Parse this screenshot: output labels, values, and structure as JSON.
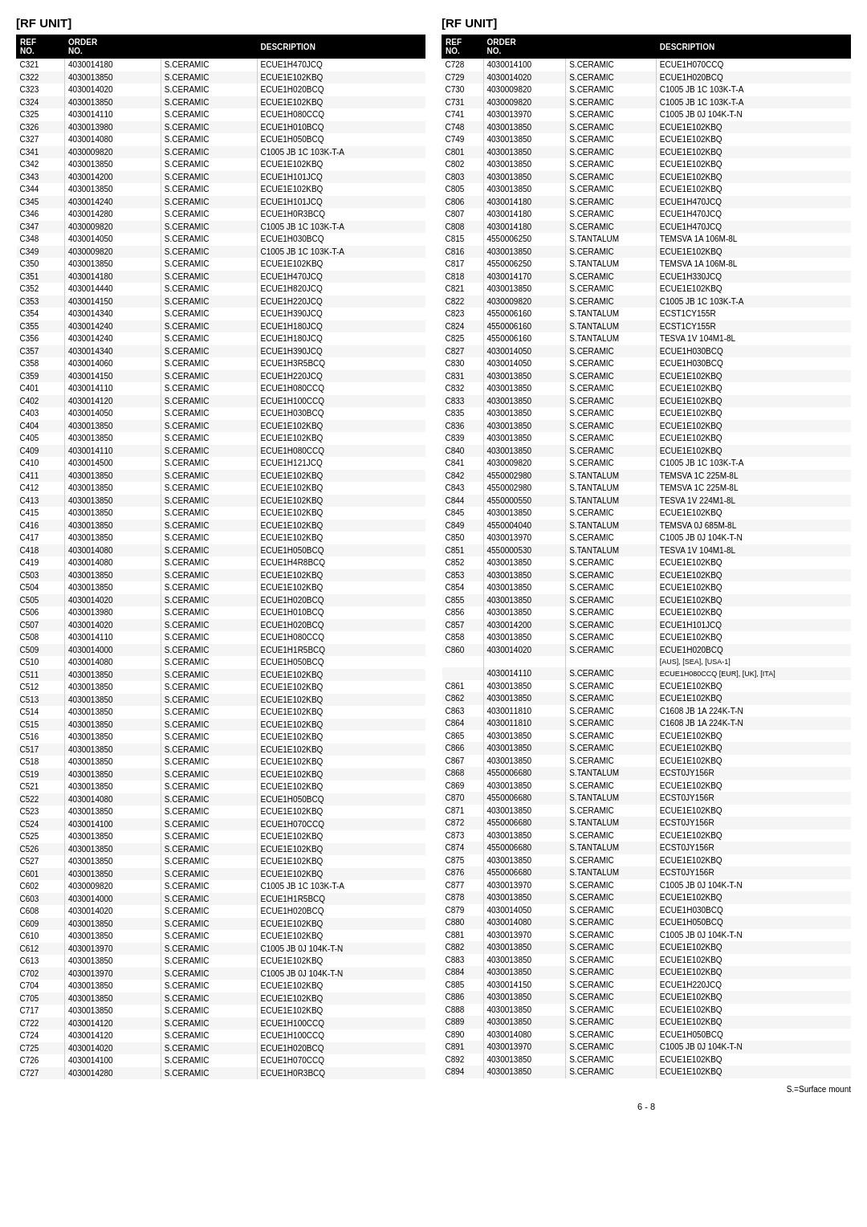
{
  "page": {
    "title_left": "[RF UNIT]",
    "title_right": "[RF UNIT]",
    "footer_note": "S.=Surface mount",
    "page_number": "6 - 8"
  },
  "left_table": {
    "headers": [
      "REF\nNO.",
      "ORDER\nNO.",
      "",
      "DESCRIPTION"
    ],
    "rows": [
      [
        "C321",
        "4030014180",
        "S.CERAMIC",
        "ECUE1H470JCQ"
      ],
      [
        "C322",
        "4030013850",
        "S.CERAMIC",
        "ECUE1E102KBQ"
      ],
      [
        "C323",
        "4030014020",
        "S.CERAMIC",
        "ECUE1H020BCQ"
      ],
      [
        "C324",
        "4030013850",
        "S.CERAMIC",
        "ECUE1E102KBQ"
      ],
      [
        "C325",
        "4030014110",
        "S.CERAMIC",
        "ECUE1H080CCQ"
      ],
      [
        "C326",
        "4030013980",
        "S.CERAMIC",
        "ECUE1H010BCQ"
      ],
      [
        "C327",
        "4030014080",
        "S.CERAMIC",
        "ECUE1H050BCQ"
      ],
      [
        "C341",
        "4030009820",
        "S.CERAMIC",
        "C1005 JB 1C 103K-T-A"
      ],
      [
        "C342",
        "4030013850",
        "S.CERAMIC",
        "ECUE1E102KBQ"
      ],
      [
        "C343",
        "4030014200",
        "S.CERAMIC",
        "ECUE1H101JCQ"
      ],
      [
        "C344",
        "4030013850",
        "S.CERAMIC",
        "ECUE1E102KBQ"
      ],
      [
        "C345",
        "4030014240",
        "S.CERAMIC",
        "ECUE1H101JCQ"
      ],
      [
        "C346",
        "4030014280",
        "S.CERAMIC",
        "ECUE1H0R3BCQ"
      ],
      [
        "C347",
        "4030009820",
        "S.CERAMIC",
        "C1005 JB 1C 103K-T-A"
      ],
      [
        "C348",
        "4030014050",
        "S.CERAMIC",
        "ECUE1H030BCQ"
      ],
      [
        "C349",
        "4030009820",
        "S.CERAMIC",
        "C1005 JB 1C 103K-T-A"
      ],
      [
        "C350",
        "4030013850",
        "S.CERAMIC",
        "ECUE1E102KBQ"
      ],
      [
        "C351",
        "4030014180",
        "S.CERAMIC",
        "ECUE1H470JCQ"
      ],
      [
        "C352",
        "4030014440",
        "S.CERAMIC",
        "ECUE1H820JCQ"
      ],
      [
        "C353",
        "4030014150",
        "S.CERAMIC",
        "ECUE1H220JCQ"
      ],
      [
        "C354",
        "4030014340",
        "S.CERAMIC",
        "ECUE1H390JCQ"
      ],
      [
        "C355",
        "4030014240",
        "S.CERAMIC",
        "ECUE1H180JCQ"
      ],
      [
        "C356",
        "4030014240",
        "S.CERAMIC",
        "ECUE1H180JCQ"
      ],
      [
        "C357",
        "4030014340",
        "S.CERAMIC",
        "ECUE1H390JCQ"
      ],
      [
        "C358",
        "4030014060",
        "S.CERAMIC",
        "ECUE1H3R5BCQ"
      ],
      [
        "C359",
        "4030014150",
        "S.CERAMIC",
        "ECUE1H220JCQ"
      ],
      [
        "C401",
        "4030014110",
        "S.CERAMIC",
        "ECUE1H080CCQ"
      ],
      [
        "C402",
        "4030014120",
        "S.CERAMIC",
        "ECUE1H100CCQ"
      ],
      [
        "C403",
        "4030014050",
        "S.CERAMIC",
        "ECUE1H030BCQ"
      ],
      [
        "C404",
        "4030013850",
        "S.CERAMIC",
        "ECUE1E102KBQ"
      ],
      [
        "C405",
        "4030013850",
        "S.CERAMIC",
        "ECUE1E102KBQ"
      ],
      [
        "C409",
        "4030014110",
        "S.CERAMIC",
        "ECUE1H080CCQ"
      ],
      [
        "C410",
        "4030014500",
        "S.CERAMIC",
        "ECUE1H121JCQ"
      ],
      [
        "C411",
        "4030013850",
        "S.CERAMIC",
        "ECUE1E102KBQ"
      ],
      [
        "C412",
        "4030013850",
        "S.CERAMIC",
        "ECUE1E102KBQ"
      ],
      [
        "C413",
        "4030013850",
        "S.CERAMIC",
        "ECUE1E102KBQ"
      ],
      [
        "C415",
        "4030013850",
        "S.CERAMIC",
        "ECUE1E102KBQ"
      ],
      [
        "C416",
        "4030013850",
        "S.CERAMIC",
        "ECUE1E102KBQ"
      ],
      [
        "C417",
        "4030013850",
        "S.CERAMIC",
        "ECUE1E102KBQ"
      ],
      [
        "C418",
        "4030014080",
        "S.CERAMIC",
        "ECUE1H050BCQ"
      ],
      [
        "C419",
        "4030014080",
        "S.CERAMIC",
        "ECUE1H4R8BCQ"
      ],
      [
        "C503",
        "4030013850",
        "S.CERAMIC",
        "ECUE1E102KBQ"
      ],
      [
        "C504",
        "4030013850",
        "S.CERAMIC",
        "ECUE1E102KBQ"
      ],
      [
        "C505",
        "4030014020",
        "S.CERAMIC",
        "ECUE1H020BCQ"
      ],
      [
        "C506",
        "4030013980",
        "S.CERAMIC",
        "ECUE1H010BCQ"
      ],
      [
        "C507",
        "4030014020",
        "S.CERAMIC",
        "ECUE1H020BCQ"
      ],
      [
        "C508",
        "4030014110",
        "S.CERAMIC",
        "ECUE1H080CCQ"
      ],
      [
        "C509",
        "4030014000",
        "S.CERAMIC",
        "ECUE1H1R5BCQ"
      ],
      [
        "C510",
        "4030014080",
        "S.CERAMIC",
        "ECUE1H050BCQ"
      ],
      [
        "C511",
        "4030013850",
        "S.CERAMIC",
        "ECUE1E102KBQ"
      ],
      [
        "C512",
        "4030013850",
        "S.CERAMIC",
        "ECUE1E102KBQ"
      ],
      [
        "C513",
        "4030013850",
        "S.CERAMIC",
        "ECUE1E102KBQ"
      ],
      [
        "C514",
        "4030013850",
        "S.CERAMIC",
        "ECUE1E102KBQ"
      ],
      [
        "C515",
        "4030013850",
        "S.CERAMIC",
        "ECUE1E102KBQ"
      ],
      [
        "C516",
        "4030013850",
        "S.CERAMIC",
        "ECUE1E102KBQ"
      ],
      [
        "C517",
        "4030013850",
        "S.CERAMIC",
        "ECUE1E102KBQ"
      ],
      [
        "C518",
        "4030013850",
        "S.CERAMIC",
        "ECUE1E102KBQ"
      ],
      [
        "C519",
        "4030013850",
        "S.CERAMIC",
        "ECUE1E102KBQ"
      ],
      [
        "C521",
        "4030013850",
        "S.CERAMIC",
        "ECUE1E102KBQ"
      ],
      [
        "C522",
        "4030014080",
        "S.CERAMIC",
        "ECUE1H050BCQ"
      ],
      [
        "C523",
        "4030013850",
        "S.CERAMIC",
        "ECUE1E102KBQ"
      ],
      [
        "C524",
        "4030014100",
        "S.CERAMIC",
        "ECUE1H070CCQ"
      ],
      [
        "C525",
        "4030013850",
        "S.CERAMIC",
        "ECUE1E102KBQ"
      ],
      [
        "C526",
        "4030013850",
        "S.CERAMIC",
        "ECUE1E102KBQ"
      ],
      [
        "C527",
        "4030013850",
        "S.CERAMIC",
        "ECUE1E102KBQ"
      ],
      [
        "C601",
        "4030013850",
        "S.CERAMIC",
        "ECUE1E102KBQ"
      ],
      [
        "C602",
        "4030009820",
        "S.CERAMIC",
        "C1005 JB 1C 103K-T-A"
      ],
      [
        "C603",
        "4030014000",
        "S.CERAMIC",
        "ECUE1H1R5BCQ"
      ],
      [
        "C608",
        "4030014020",
        "S.CERAMIC",
        "ECUE1H020BCQ"
      ],
      [
        "C609",
        "4030013850",
        "S.CERAMIC",
        "ECUE1E102KBQ"
      ],
      [
        "C610",
        "4030013850",
        "S.CERAMIC",
        "ECUE1E102KBQ"
      ],
      [
        "C612",
        "4030013970",
        "S.CERAMIC",
        "C1005 JB 0J 104K-T-N"
      ],
      [
        "C613",
        "4030013850",
        "S.CERAMIC",
        "ECUE1E102KBQ"
      ],
      [
        "C702",
        "4030013970",
        "S.CERAMIC",
        "C1005 JB 0J 104K-T-N"
      ],
      [
        "C704",
        "4030013850",
        "S.CERAMIC",
        "ECUE1E102KBQ"
      ],
      [
        "C705",
        "4030013850",
        "S.CERAMIC",
        "ECUE1E102KBQ"
      ],
      [
        "C717",
        "4030013850",
        "S.CERAMIC",
        "ECUE1E102KBQ"
      ],
      [
        "C722",
        "4030014120",
        "S.CERAMIC",
        "ECUE1H100CCQ"
      ],
      [
        "C724",
        "4030014120",
        "S.CERAMIC",
        "ECUE1H100CCQ"
      ],
      [
        "C725",
        "4030014020",
        "S.CERAMIC",
        "ECUE1H020BCQ"
      ],
      [
        "C726",
        "4030014100",
        "S.CERAMIC",
        "ECUE1H070CCQ"
      ],
      [
        "C727",
        "4030014280",
        "S.CERAMIC",
        "ECUE1H0R3BCQ"
      ]
    ]
  },
  "right_table": {
    "headers": [
      "REF\nNO.",
      "ORDER\nNO.",
      "",
      "DESCRIPTION"
    ],
    "rows": [
      [
        "C728",
        "4030014100",
        "S.CERAMIC",
        "ECUE1H070CCQ"
      ],
      [
        "C729",
        "4030014020",
        "S.CERAMIC",
        "ECUE1H020BCQ"
      ],
      [
        "C730",
        "4030009820",
        "S.CERAMIC",
        "C1005 JB 1C 103K-T-A"
      ],
      [
        "C731",
        "4030009820",
        "S.CERAMIC",
        "C1005 JB 1C 103K-T-A"
      ],
      [
        "C741",
        "4030013970",
        "S.CERAMIC",
        "C1005 JB 0J 104K-T-N"
      ],
      [
        "C748",
        "4030013850",
        "S.CERAMIC",
        "ECUE1E102KBQ"
      ],
      [
        "C749",
        "4030013850",
        "S.CERAMIC",
        "ECUE1E102KBQ"
      ],
      [
        "C801",
        "4030013850",
        "S.CERAMIC",
        "ECUE1E102KBQ"
      ],
      [
        "C802",
        "4030013850",
        "S.CERAMIC",
        "ECUE1E102KBQ"
      ],
      [
        "C803",
        "4030013850",
        "S.CERAMIC",
        "ECUE1E102KBQ"
      ],
      [
        "C805",
        "4030013850",
        "S.CERAMIC",
        "ECUE1E102KBQ"
      ],
      [
        "C806",
        "4030014180",
        "S.CERAMIC",
        "ECUE1H470JCQ"
      ],
      [
        "C807",
        "4030014180",
        "S.CERAMIC",
        "ECUE1H470JCQ"
      ],
      [
        "C808",
        "4030014180",
        "S.CERAMIC",
        "ECUE1H470JCQ"
      ],
      [
        "C815",
        "4550006250",
        "S.TANTALUM",
        "TEMSVA 1A 106M-8L"
      ],
      [
        "C816",
        "4030013850",
        "S.CERAMIC",
        "ECUE1E102KBQ"
      ],
      [
        "C817",
        "4550006250",
        "S.TANTALUM",
        "TEMSVA 1A 106M-8L"
      ],
      [
        "C818",
        "4030014170",
        "S.CERAMIC",
        "ECUE1H330JCQ"
      ],
      [
        "C821",
        "4030013850",
        "S.CERAMIC",
        "ECUE1E102KBQ"
      ],
      [
        "C822",
        "4030009820",
        "S.CERAMIC",
        "C1005 JB 1C 103K-T-A"
      ],
      [
        "C823",
        "4550006160",
        "S.TANTALUM",
        "ECST1CY155R"
      ],
      [
        "C824",
        "4550006160",
        "S.TANTALUM",
        "ECST1CY155R"
      ],
      [
        "C825",
        "4550006160",
        "S.TANTALUM",
        "TESVA 1V 104M1-8L"
      ],
      [
        "C827",
        "4030014050",
        "S.CERAMIC",
        "ECUE1H030BCQ"
      ],
      [
        "C830",
        "4030014050",
        "S.CERAMIC",
        "ECUE1H030BCQ"
      ],
      [
        "C831",
        "4030013850",
        "S.CERAMIC",
        "ECUE1E102KBQ"
      ],
      [
        "C832",
        "4030013850",
        "S.CERAMIC",
        "ECUE1E102KBQ"
      ],
      [
        "C833",
        "4030013850",
        "S.CERAMIC",
        "ECUE1E102KBQ"
      ],
      [
        "C835",
        "4030013850",
        "S.CERAMIC",
        "ECUE1E102KBQ"
      ],
      [
        "C836",
        "4030013850",
        "S.CERAMIC",
        "ECUE1E102KBQ"
      ],
      [
        "C839",
        "4030013850",
        "S.CERAMIC",
        "ECUE1E102KBQ"
      ],
      [
        "C840",
        "4030013850",
        "S.CERAMIC",
        "ECUE1E102KBQ"
      ],
      [
        "C841",
        "4030009820",
        "S.CERAMIC",
        "C1005 JB 1C 103K-T-A"
      ],
      [
        "C842",
        "4550002980",
        "S.TANTALUM",
        "TEMSVA 1C 225M-8L"
      ],
      [
        "C843",
        "4550002980",
        "S.TANTALUM",
        "TEMSVA 1C 225M-8L"
      ],
      [
        "C844",
        "4550000550",
        "S.TANTALUM",
        "TESVA 1V 224M1-8L"
      ],
      [
        "C845",
        "4030013850",
        "S.CERAMIC",
        "ECUE1E102KBQ"
      ],
      [
        "C849",
        "4550004040",
        "S.TANTALUM",
        "TEMSVA 0J 685M-8L"
      ],
      [
        "C850",
        "4030013970",
        "S.CERAMIC",
        "C1005 JB 0J 104K-T-N"
      ],
      [
        "C851",
        "4550000530",
        "S.TANTALUM",
        "TESVA 1V 104M1-8L"
      ],
      [
        "C852",
        "4030013850",
        "S.CERAMIC",
        "ECUE1E102KBQ"
      ],
      [
        "C853",
        "4030013850",
        "S.CERAMIC",
        "ECUE1E102KBQ"
      ],
      [
        "C854",
        "4030013850",
        "S.CERAMIC",
        "ECUE1E102KBQ"
      ],
      [
        "C855",
        "4030013850",
        "S.CERAMIC",
        "ECUE1E102KBQ"
      ],
      [
        "C856",
        "4030013850",
        "S.CERAMIC",
        "ECUE1E102KBQ"
      ],
      [
        "C857",
        "4030014200",
        "S.CERAMIC",
        "ECUE1H101JCQ"
      ],
      [
        "C858",
        "4030013850",
        "S.CERAMIC",
        "ECUE1E102KBQ"
      ],
      [
        "C860",
        "4030014020",
        "S.CERAMIC",
        "ECUE1H020BCQ"
      ],
      [
        "",
        "",
        "",
        "[AUS], [SEA], [USA-1]"
      ],
      [
        "",
        "4030014110",
        "S.CERAMIC",
        "ECUE1H080CCQ [EUR], [UK], [ITA]"
      ],
      [
        "C861",
        "4030013850",
        "S.CERAMIC",
        "ECUE1E102KBQ"
      ],
      [
        "C862",
        "4030013850",
        "S.CERAMIC",
        "ECUE1E102KBQ"
      ],
      [
        "C863",
        "4030011810",
        "S.CERAMIC",
        "C1608 JB 1A 224K-T-N"
      ],
      [
        "C864",
        "4030011810",
        "S.CERAMIC",
        "C1608 JB 1A 224K-T-N"
      ],
      [
        "C865",
        "4030013850",
        "S.CERAMIC",
        "ECUE1E102KBQ"
      ],
      [
        "C866",
        "4030013850",
        "S.CERAMIC",
        "ECUE1E102KBQ"
      ],
      [
        "C867",
        "4030013850",
        "S.CERAMIC",
        "ECUE1E102KBQ"
      ],
      [
        "C868",
        "4550006680",
        "S.TANTALUM",
        "ECST0JY156R"
      ],
      [
        "C869",
        "4030013850",
        "S.CERAMIC",
        "ECUE1E102KBQ"
      ],
      [
        "C870",
        "4550006680",
        "S.TANTALUM",
        "ECST0JY156R"
      ],
      [
        "C871",
        "4030013850",
        "S.CERAMIC",
        "ECUE1E102KBQ"
      ],
      [
        "C872",
        "4550006680",
        "S.TANTALUM",
        "ECST0JY156R"
      ],
      [
        "C873",
        "4030013850",
        "S.CERAMIC",
        "ECUE1E102KBQ"
      ],
      [
        "C874",
        "4550006680",
        "S.TANTALUM",
        "ECST0JY156R"
      ],
      [
        "C875",
        "4030013850",
        "S.CERAMIC",
        "ECUE1E102KBQ"
      ],
      [
        "C876",
        "4550006680",
        "S.TANTALUM",
        "ECST0JY156R"
      ],
      [
        "C877",
        "4030013970",
        "S.CERAMIC",
        "C1005 JB 0J 104K-T-N"
      ],
      [
        "C878",
        "4030013850",
        "S.CERAMIC",
        "ECUE1E102KBQ"
      ],
      [
        "C879",
        "4030014050",
        "S.CERAMIC",
        "ECUE1H030BCQ"
      ],
      [
        "C880",
        "4030014080",
        "S.CERAMIC",
        "ECUE1H050BCQ"
      ],
      [
        "C881",
        "4030013970",
        "S.CERAMIC",
        "C1005 JB 0J 104K-T-N"
      ],
      [
        "C882",
        "4030013850",
        "S.CERAMIC",
        "ECUE1E102KBQ"
      ],
      [
        "C883",
        "4030013850",
        "S.CERAMIC",
        "ECUE1E102KBQ"
      ],
      [
        "C884",
        "4030013850",
        "S.CERAMIC",
        "ECUE1E102KBQ"
      ],
      [
        "C885",
        "4030014150",
        "S.CERAMIC",
        "ECUE1H220JCQ"
      ],
      [
        "C886",
        "4030013850",
        "S.CERAMIC",
        "ECUE1E102KBQ"
      ],
      [
        "C888",
        "4030013850",
        "S.CERAMIC",
        "ECUE1E102KBQ"
      ],
      [
        "C889",
        "4030013850",
        "S.CERAMIC",
        "ECUE1E102KBQ"
      ],
      [
        "C890",
        "4030014080",
        "S.CERAMIC",
        "ECUE1H050BCQ"
      ],
      [
        "C891",
        "4030013970",
        "S.CERAMIC",
        "C1005 JB 0J 104K-T-N"
      ],
      [
        "C892",
        "4030013850",
        "S.CERAMIC",
        "ECUE1E102KBQ"
      ],
      [
        "C894",
        "4030013850",
        "S.CERAMIC",
        "ECUE1E102KBQ"
      ]
    ]
  }
}
